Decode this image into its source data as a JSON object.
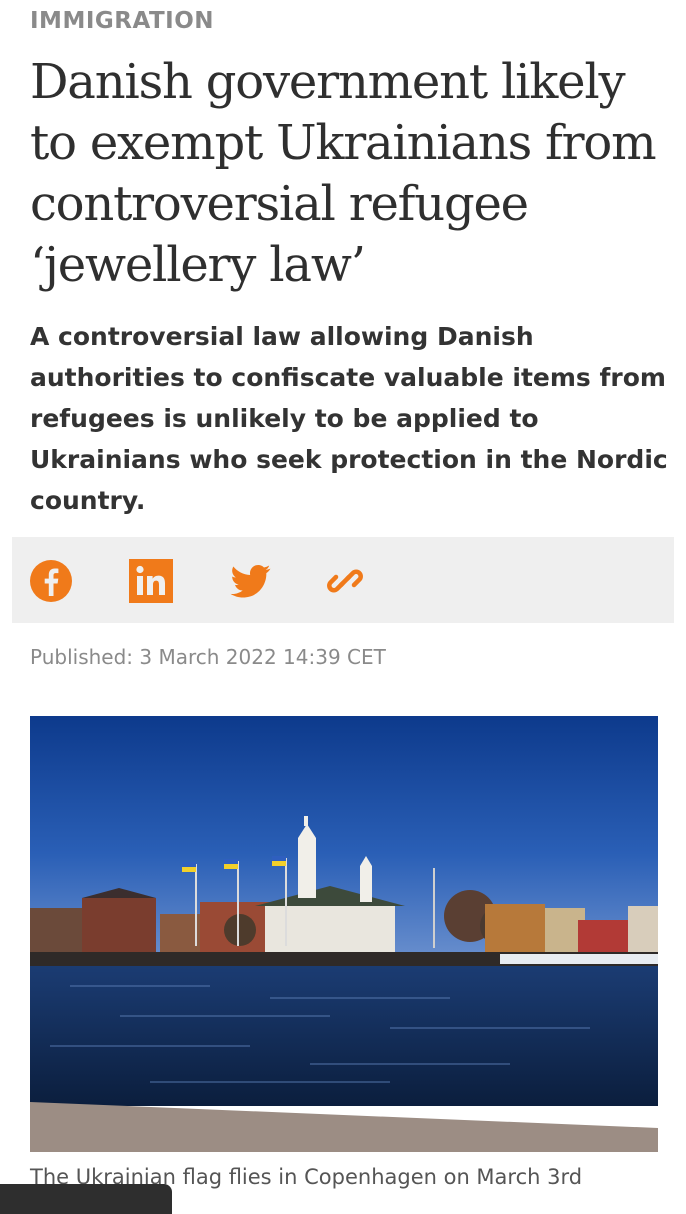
{
  "category": "IMMIGRATION",
  "headline": "Danish government likely to exempt Ukrainians from controversial refugee ‘jewellery law’",
  "standfirst": "A controversial law allowing Danish authorities to confiscate valuable items from refugees is unlikely to be applied to Ukrainians who seek protection in the Nordic country.",
  "share": {
    "icons": [
      "facebook-icon",
      "linkedin-icon",
      "twitter-icon",
      "link-icon"
    ],
    "accent_color": "#f07a1a"
  },
  "published": "Published: 3 March 2022 14:39 CET",
  "caption": "The Ukrainian flag flies in Copenhagen on March 3rd"
}
